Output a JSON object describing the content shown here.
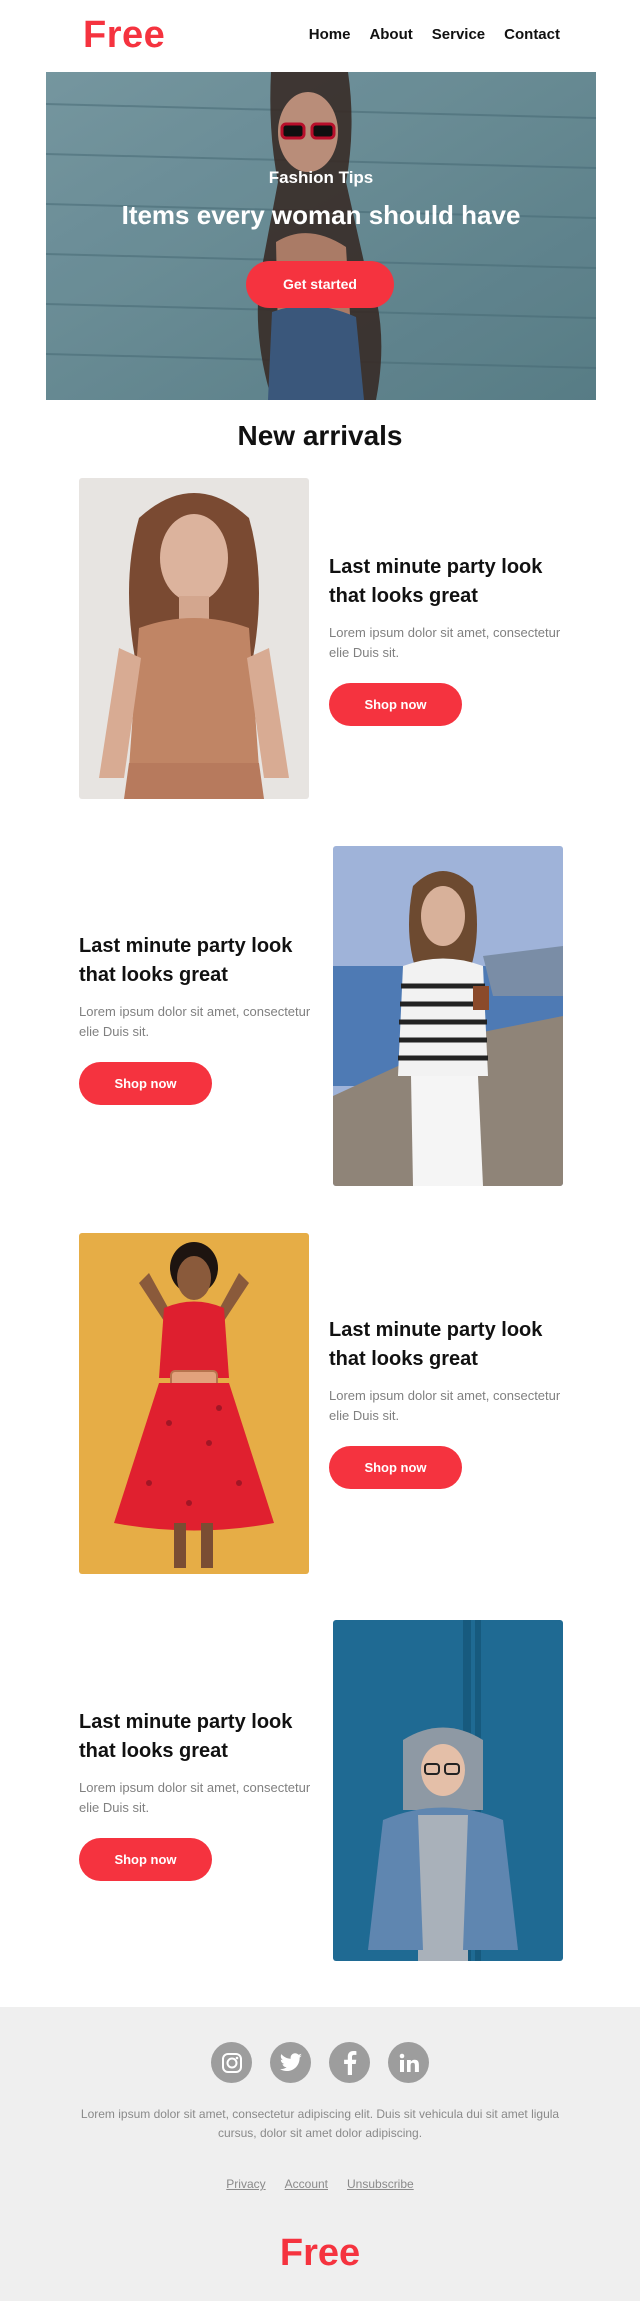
{
  "brand": {
    "logo": "Free",
    "accent": "#f5333f"
  },
  "nav": {
    "items": [
      {
        "label": "Home"
      },
      {
        "label": "About"
      },
      {
        "label": "Service"
      },
      {
        "label": "Contact"
      }
    ]
  },
  "hero": {
    "eyebrow": "Fashion Tips",
    "title": "Items every woman should have",
    "cta": "Get started"
  },
  "arrivals": {
    "title": "New arrivals",
    "products": [
      {
        "title": "Last minute party look that looks great",
        "desc": "Lorem ipsum dolor sit amet, consectetur elie Duis sit.",
        "cta": "Shop now"
      },
      {
        "title": "Last minute party look that looks great",
        "desc": "Lorem ipsum dolor sit amet, consectetur elie Duis sit.",
        "cta": "Shop now"
      },
      {
        "title": "Last minute party look that looks great",
        "desc": "Lorem ipsum dolor sit amet, consectetur elie Duis sit.",
        "cta": "Shop now"
      },
      {
        "title": "Last minute party look that looks great",
        "desc": "Lorem ipsum dolor sit amet, consectetur elie Duis sit.",
        "cta": "Shop now"
      }
    ]
  },
  "footer": {
    "socials": [
      {
        "icon": "instagram-icon"
      },
      {
        "icon": "twitter-icon"
      },
      {
        "icon": "facebook-icon"
      },
      {
        "icon": "linkedin-icon"
      }
    ],
    "text": "Lorem ipsum dolor sit amet, consectetur adipiscing elit. Duis sit vehicula dui sit amet ligula cursus, dolor sit amet dolor adipiscing.",
    "links": [
      {
        "label": "Privacy"
      },
      {
        "label": "Account"
      },
      {
        "label": "Unsubscribe"
      }
    ],
    "logo": "Free"
  }
}
